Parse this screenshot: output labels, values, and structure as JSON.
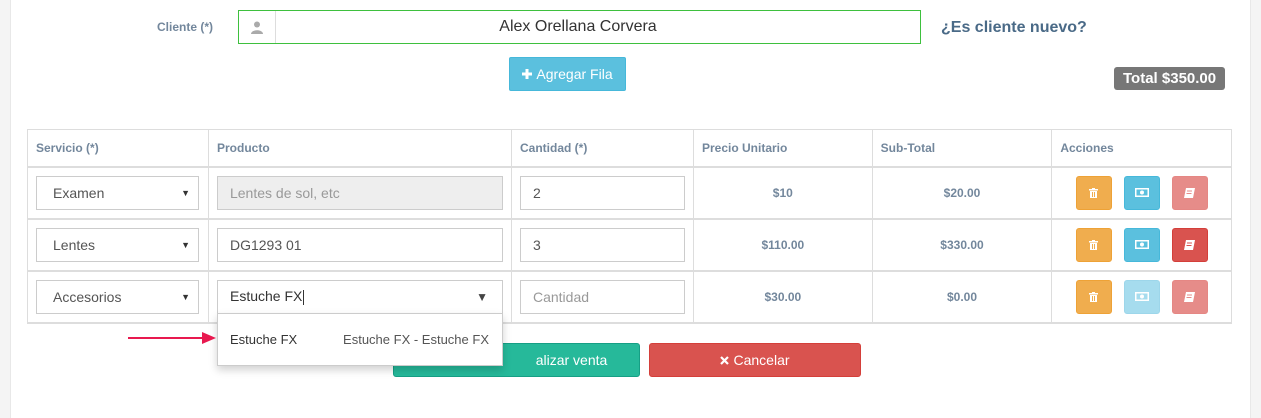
{
  "client": {
    "label": "Cliente (*)",
    "value": "Alex  Orellana Corvera",
    "new_client_link": "¿Es cliente nuevo?"
  },
  "toolbar": {
    "add_row_label": "Agregar Fila",
    "total_label": "Total $350.00"
  },
  "table": {
    "headers": [
      "Servicio (*)",
      "Producto",
      "Cantidad (*)",
      "Precio Unitario",
      "Sub-Total",
      "Acciones"
    ],
    "rows": [
      {
        "service": "Examen",
        "product": "",
        "product_placeholder": "Lentes de sol, etc",
        "quantity": "2",
        "unit_price": "$10",
        "subtotal": "$20.00"
      },
      {
        "service": "Lentes",
        "product": "DG1293 01",
        "quantity": "3",
        "unit_price": "$110.00",
        "subtotal": "$330.00"
      },
      {
        "service": "Accesorios",
        "product": "Estuche FX",
        "quantity": "",
        "quantity_placeholder": "Cantidad",
        "unit_price": "$30.00",
        "subtotal": "$0.00"
      }
    ]
  },
  "dropdown": {
    "option_name": "Estuche FX",
    "option_detail": "Estuche FX - Estuche FX"
  },
  "footer": {
    "finalize_label": "alizar venta",
    "cancel_label": "Cancelar"
  },
  "icons": {
    "user": "user-icon",
    "plus": "plus-icon",
    "trash": "trash-icon",
    "money": "money-icon",
    "book": "book-icon",
    "close": "close-icon",
    "caret": "caret-down-icon"
  },
  "colors": {
    "accent_green": "#26b99a",
    "info": "#5bc0de",
    "warning": "#f0ad4e",
    "danger": "#d9534f",
    "arrow": "#e8194f"
  }
}
